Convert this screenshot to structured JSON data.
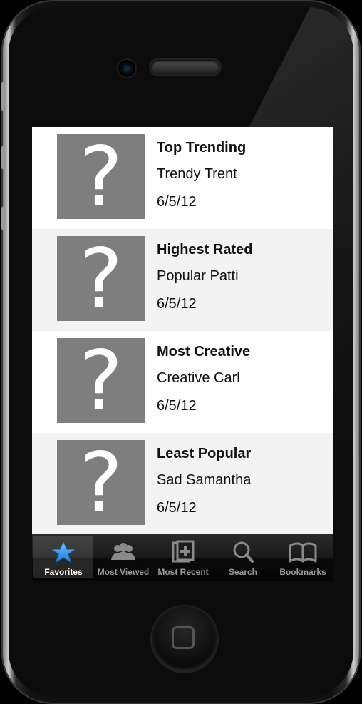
{
  "list": {
    "items": [
      {
        "title": "Top Trending",
        "name": "Trendy Trent",
        "date": "6/5/12",
        "thumb_glyph": "?"
      },
      {
        "title": "Highest Rated",
        "name": "Popular Patti",
        "date": "6/5/12",
        "thumb_glyph": "?"
      },
      {
        "title": "Most Creative",
        "name": "Creative Carl",
        "date": "6/5/12",
        "thumb_glyph": "?"
      },
      {
        "title": "Least Popular",
        "name": "Sad Samantha",
        "date": "6/5/12",
        "thumb_glyph": "?"
      }
    ]
  },
  "tabbar": {
    "tabs": [
      {
        "label": "Favorites",
        "icon": "star-icon",
        "active": true
      },
      {
        "label": "Most Viewed",
        "icon": "people-icon",
        "active": false
      },
      {
        "label": "Most Recent",
        "icon": "add-note-icon",
        "active": false
      },
      {
        "label": "Search",
        "icon": "search-icon",
        "active": false
      },
      {
        "label": "Bookmarks",
        "icon": "book-icon",
        "active": false
      }
    ]
  },
  "colors": {
    "active_tab": "#2f8fe8",
    "placeholder_thumb": "#7e7e7e",
    "row_alt": "#f3f3f3"
  }
}
